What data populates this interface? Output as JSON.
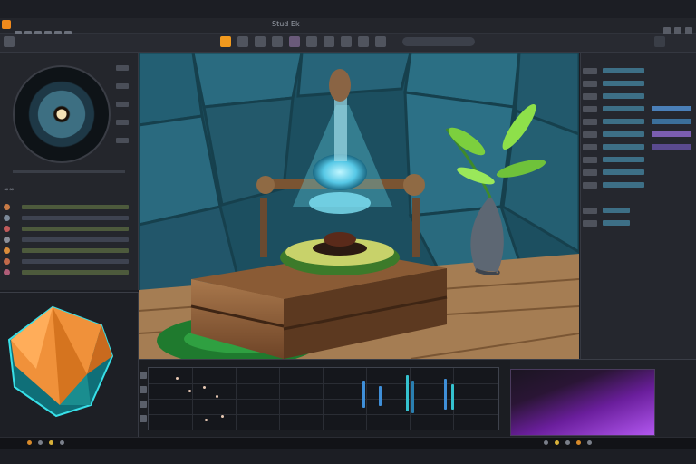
{
  "window": {
    "title": "Stud Ek"
  },
  "toolbar": {
    "tools": [
      "select-tool",
      "move-tool",
      "rotate-tool",
      "scale-tool",
      "paint-tool",
      "sculpt-tool",
      "cut-tool",
      "brush-tool",
      "fill-tool",
      "light-tool",
      "camera-tool",
      "render-tool"
    ]
  },
  "left_panel": {
    "section_label": "∞∞"
  },
  "colors": {
    "accent": "#f29a1e",
    "timeline_key_blue": "#3f8fd8",
    "timeline_key_cyan": "#35c2cf",
    "preview_purple": "#a34ae6"
  }
}
